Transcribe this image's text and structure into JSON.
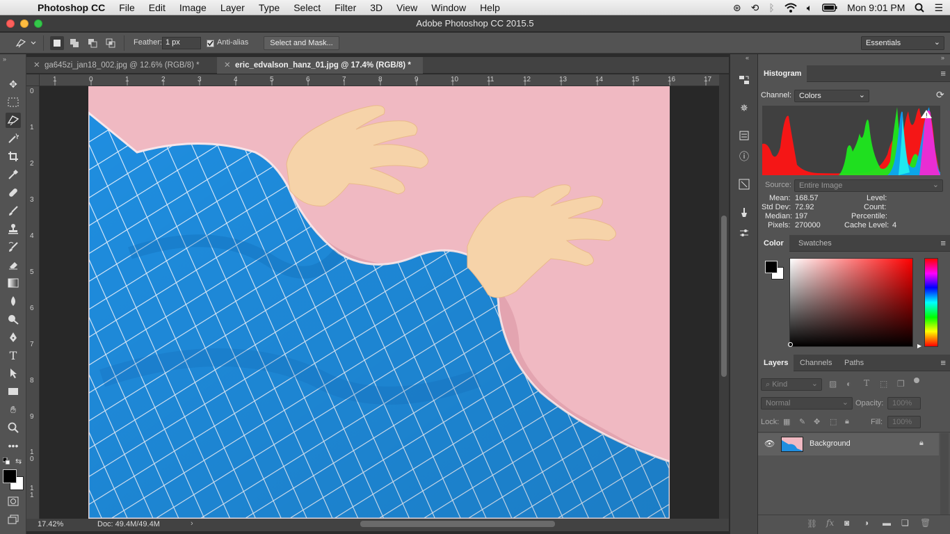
{
  "menubar": {
    "app_name": "Photoshop CC",
    "items": [
      "File",
      "Edit",
      "Image",
      "Layer",
      "Type",
      "Select",
      "Filter",
      "3D",
      "View",
      "Window",
      "Help"
    ],
    "clock": "Mon 9:01 PM"
  },
  "window": {
    "title": "Adobe Photoshop CC 2015.5"
  },
  "options": {
    "feather_label": "Feather:",
    "feather_value": "1 px",
    "anti_alias_label": "Anti-alias",
    "anti_alias_checked": true,
    "select_mask_label": "Select and Mask...",
    "workspace": "Essentials"
  },
  "tabs": [
    {
      "label": "ga645zi_jan18_002.jpg @ 12.6% (RGB/8) *",
      "active": false
    },
    {
      "label": "eric_edvalson_hanz_01.jpg @ 17.4% (RGB/8) *",
      "active": true
    }
  ],
  "ruler": {
    "h_ticks": [
      "1",
      "0",
      "1",
      "2",
      "3",
      "4",
      "5",
      "6",
      "7",
      "8",
      "9",
      "10",
      "11",
      "12",
      "13",
      "14",
      "15",
      "16",
      "17"
    ],
    "v_ticks": [
      "0",
      "1",
      "2",
      "3",
      "4",
      "5",
      "6",
      "7",
      "8",
      "9",
      "1\n0",
      "1\n1"
    ]
  },
  "status": {
    "zoom": "17.42%",
    "doc": "Doc: 49.4M/49.4M"
  },
  "histogram": {
    "tab": "Histogram",
    "channel_label": "Channel:",
    "channel_value": "Colors",
    "source_label": "Source:",
    "source_value": "Entire Image",
    "mean_label": "Mean:",
    "mean": "168.57",
    "stddev_label": "Std Dev:",
    "stddev": "72.92",
    "median_label": "Median:",
    "median": "197",
    "pixels_label": "Pixels:",
    "pixels": "270000",
    "level_label": "Level:",
    "count_label": "Count:",
    "percentile_label": "Percentile:",
    "cache_label": "Cache Level:",
    "cache": "4"
  },
  "color_panel": {
    "tabs": [
      "Color",
      "Swatches"
    ]
  },
  "layers_panel": {
    "tabs": [
      "Layers",
      "Channels",
      "Paths"
    ],
    "kind_label": "Kind",
    "blend_mode": "Normal",
    "opacity_label": "Opacity:",
    "opacity": "100%",
    "lock_label": "Lock:",
    "fill_label": "Fill:",
    "fill": "100%",
    "layers": [
      {
        "name": "Background",
        "visible": true,
        "locked": true
      }
    ]
  },
  "colors": {
    "canvas_pink": "#f0b9c2",
    "grid_blue": "#1c8fe0",
    "accent": "#535353"
  }
}
